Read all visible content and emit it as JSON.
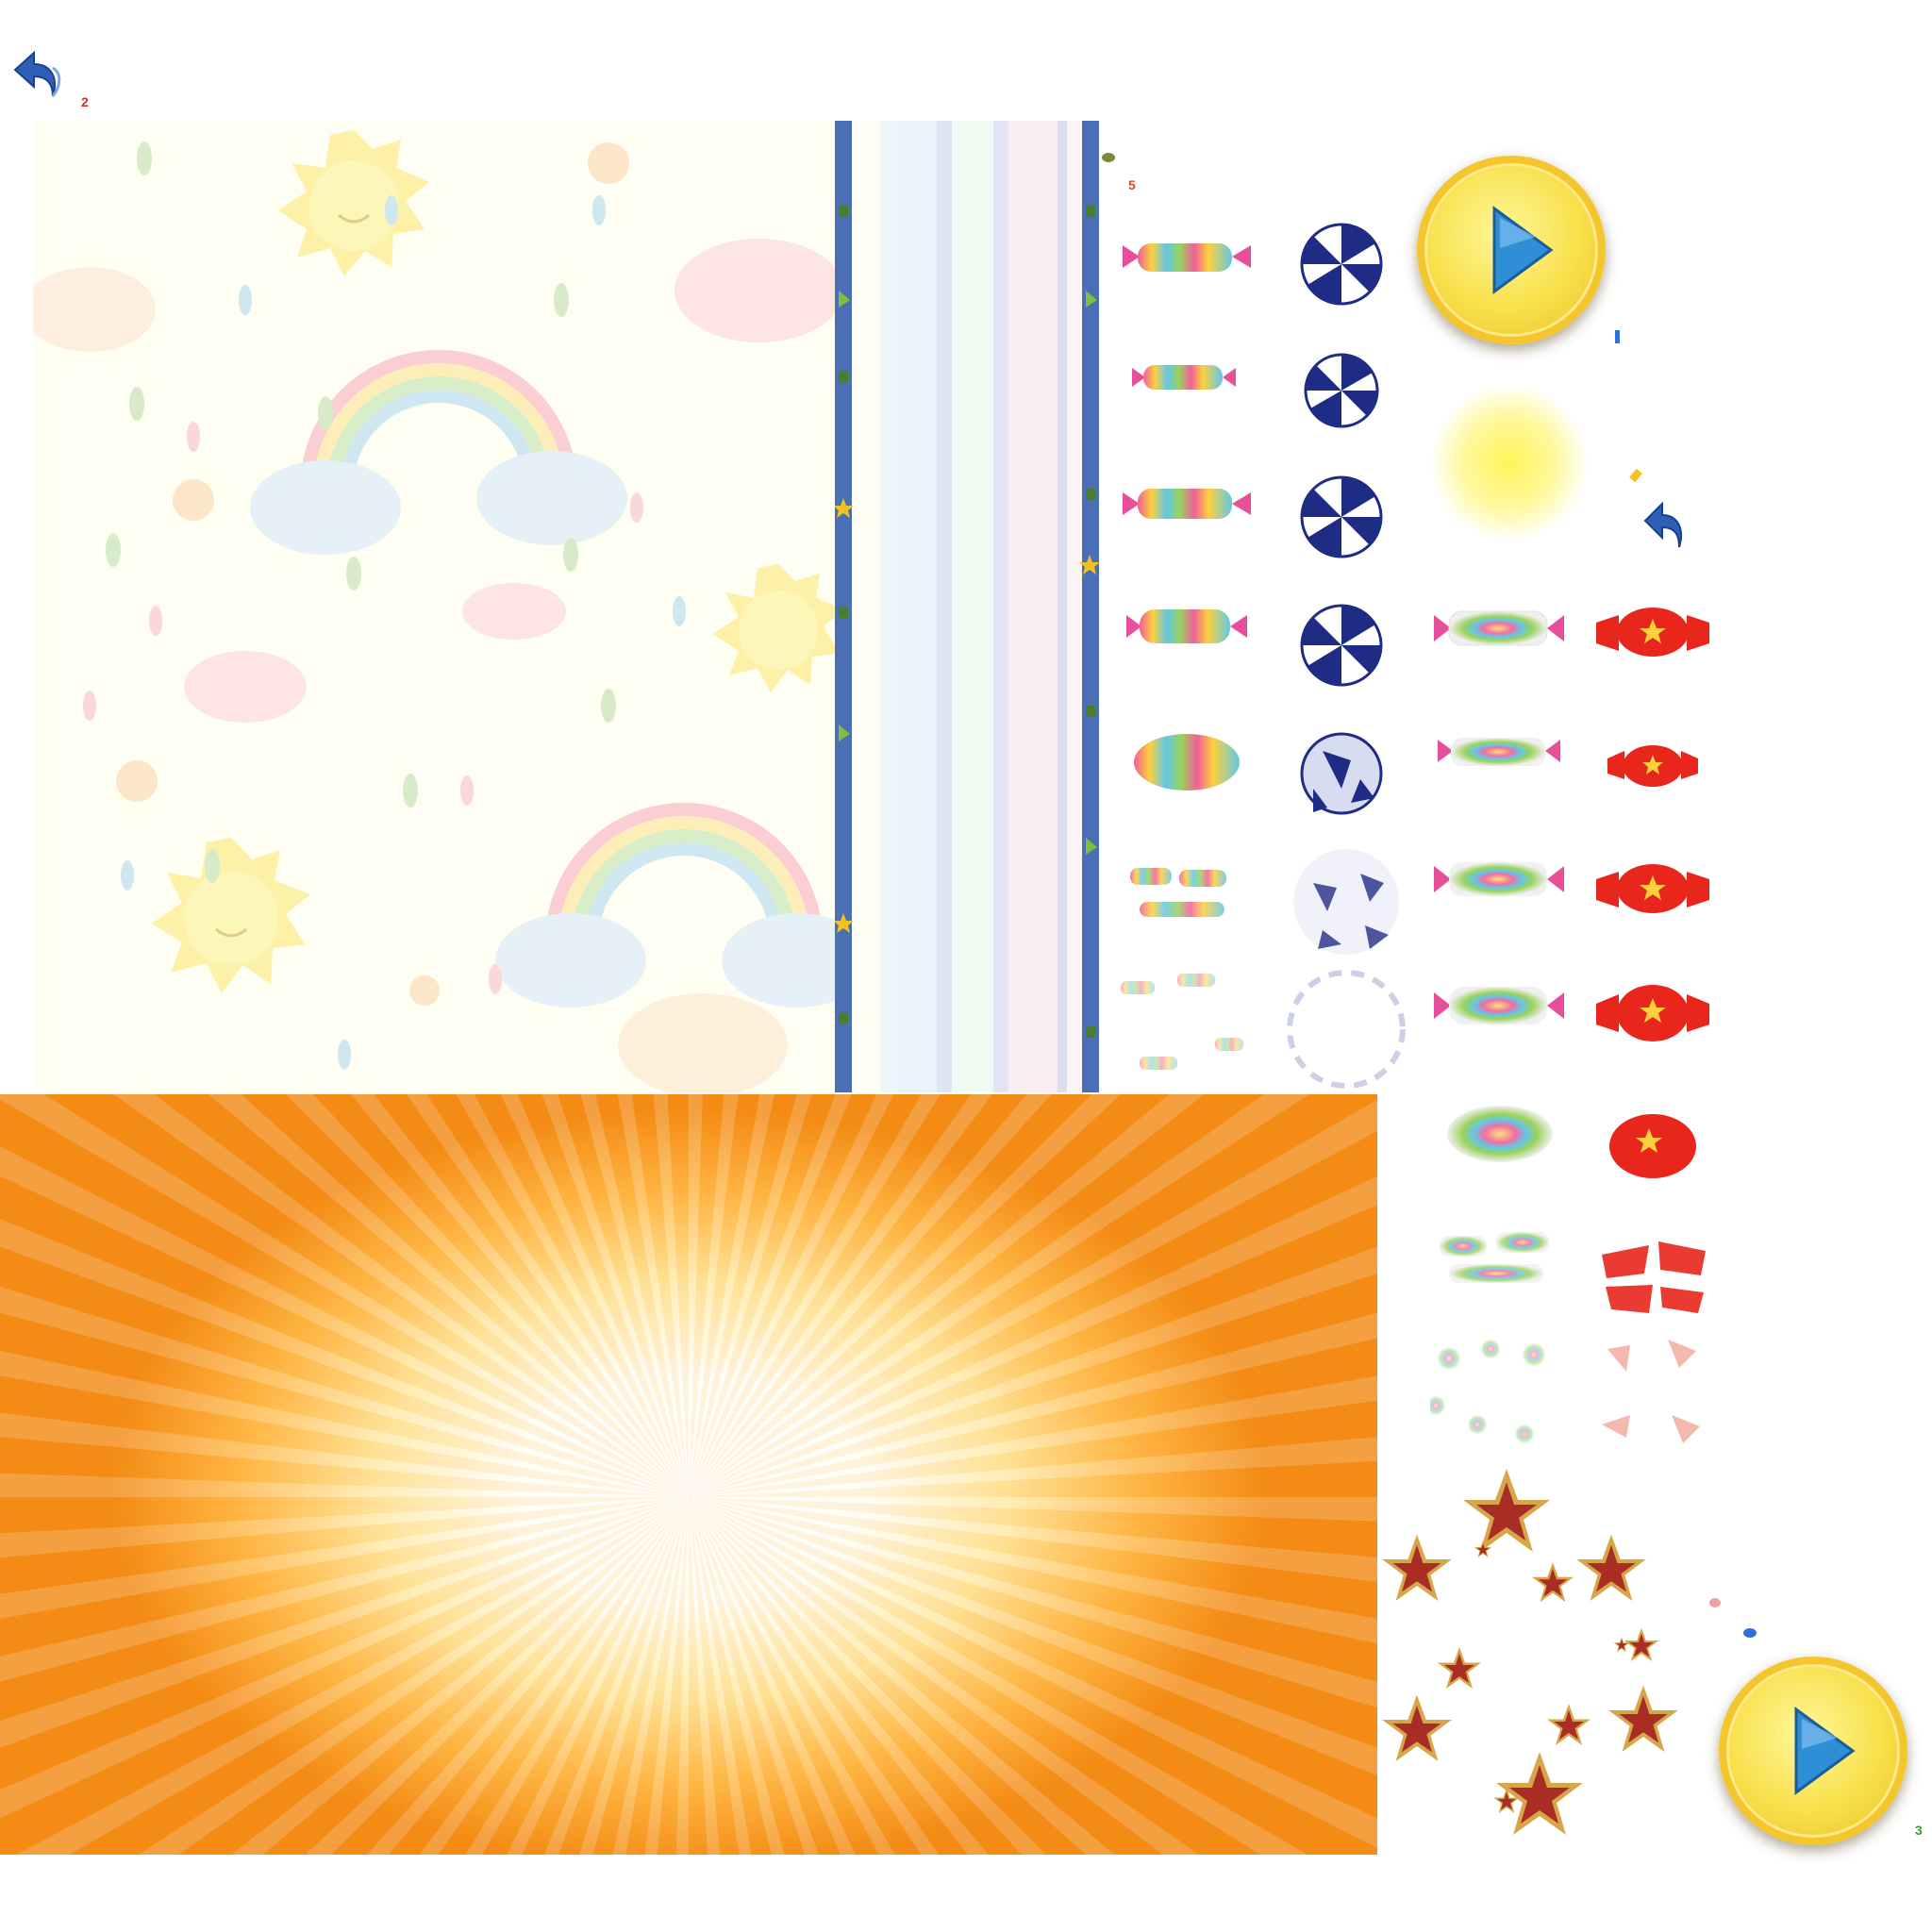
{
  "atlas": {
    "description_free": true,
    "glyph_labels": [
      "2",
      "5",
      "3"
    ],
    "buttons": {
      "play": "play",
      "back": "back"
    },
    "colors": {
      "wallpaper_bg": "#fffef2",
      "sunburst_center": "#ffffff",
      "sunburst_edge": "#f28a16",
      "play_yellow": "#f8e04a",
      "play_arrow": "#2f8fd6",
      "candy_blue": "#1f2c86",
      "candy_red": "#e8261c",
      "star_red": "#a82d25",
      "star_gold": "#d8a64a",
      "back_arrow": "#2e5fb7"
    },
    "icons": [
      "back-arrow-icon",
      "play-icon",
      "sun-icon",
      "rainbow-icon",
      "cloud-icon",
      "star-icon",
      "candy-icon"
    ]
  }
}
